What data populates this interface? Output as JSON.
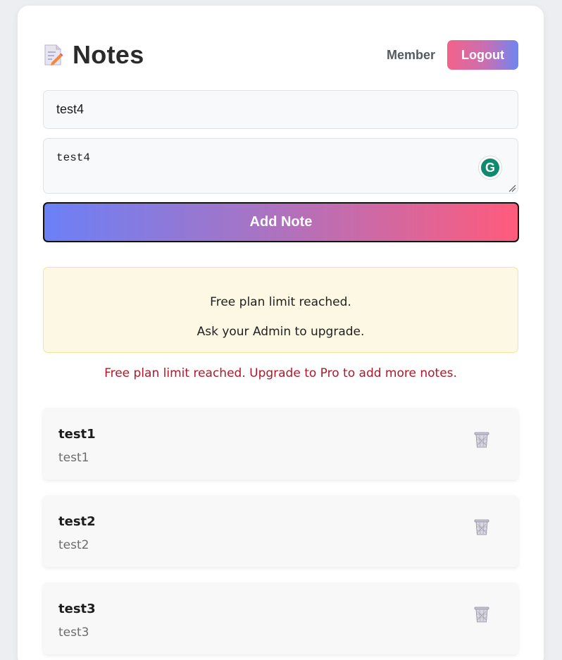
{
  "header": {
    "title": "Notes",
    "title_icon": "memo-icon",
    "role": "Member",
    "logout_label": "Logout"
  },
  "form": {
    "title_value": "test4",
    "body_value": "test4",
    "submit_label": "Add Note"
  },
  "limit_notice": {
    "line1": "Free plan limit reached.",
    "line2": "Ask your Admin to upgrade."
  },
  "error_message": "Free plan limit reached. Upgrade to Pro to add more notes.",
  "notes": [
    {
      "title": "test1",
      "body": "test1"
    },
    {
      "title": "test2",
      "body": "test2"
    },
    {
      "title": "test3",
      "body": "test3"
    }
  ],
  "colors": {
    "accent_pink": "#ff5b7c",
    "accent_blue": "#6b80f6",
    "warning_bg": "#fdf8e4",
    "error_text": "#b0182a"
  }
}
